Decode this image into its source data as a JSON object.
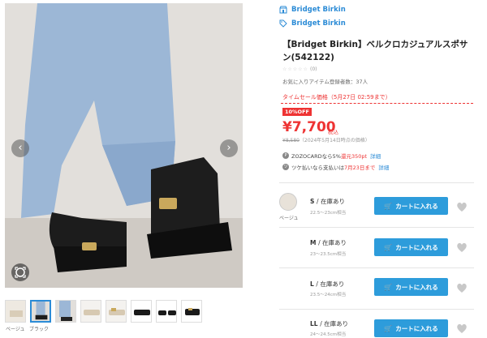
{
  "brand": {
    "primary": "Bridget Birkin",
    "secondary": "Bridget Birkin"
  },
  "product": {
    "title": "【Bridget Birkin】ベルクロカジュアルスポサン(542122)",
    "stars": "☆☆☆☆☆",
    "review_count": "(0)",
    "fav_text": "お気に入りアイテム登録者数：37人",
    "sale_text": "タイムセール価格（5月27日 02:59まで）",
    "off_badge": "10%OFF",
    "price": "¥7,700",
    "tax_label": "税込",
    "old_price": "¥8,580",
    "old_price_note": "（2024年5月14日時点の価格）",
    "point_prefix": "ZOZOCARDなら5%",
    "point_value": "還元350pt",
    "point_link": "詳細",
    "tsuke_prefix": "ツケ払いなら支払いは",
    "tsuke_date": "7月23日まで",
    "tsuke_link": "詳細"
  },
  "gallery": {
    "prev_label": "‹",
    "next_label": "›",
    "thumb_captions": [
      "ベージュ",
      "ブラック"
    ]
  },
  "variant": {
    "color_name": "ベージュ"
  },
  "sizes": [
    {
      "name": "S",
      "stock": "/ 在庫あり",
      "range": "22.5〜23cm相当",
      "cart_label": "カートに入れる"
    },
    {
      "name": "M",
      "stock": "/ 在庫あり",
      "range": "23〜23.5cm相当",
      "cart_label": "カートに入れる"
    },
    {
      "name": "L",
      "stock": "/ 在庫あり",
      "range": "23.5〜24cm相当",
      "cart_label": "カートに入れる"
    },
    {
      "name": "LL",
      "stock": "/ 在庫あり",
      "range": "24〜24.5cm相当",
      "cart_label": "カートに入れる"
    }
  ],
  "colors": {
    "accent_blue": "#2d9cdb",
    "sale_red": "#e33333",
    "heart_grey": "#c8c8c8"
  }
}
